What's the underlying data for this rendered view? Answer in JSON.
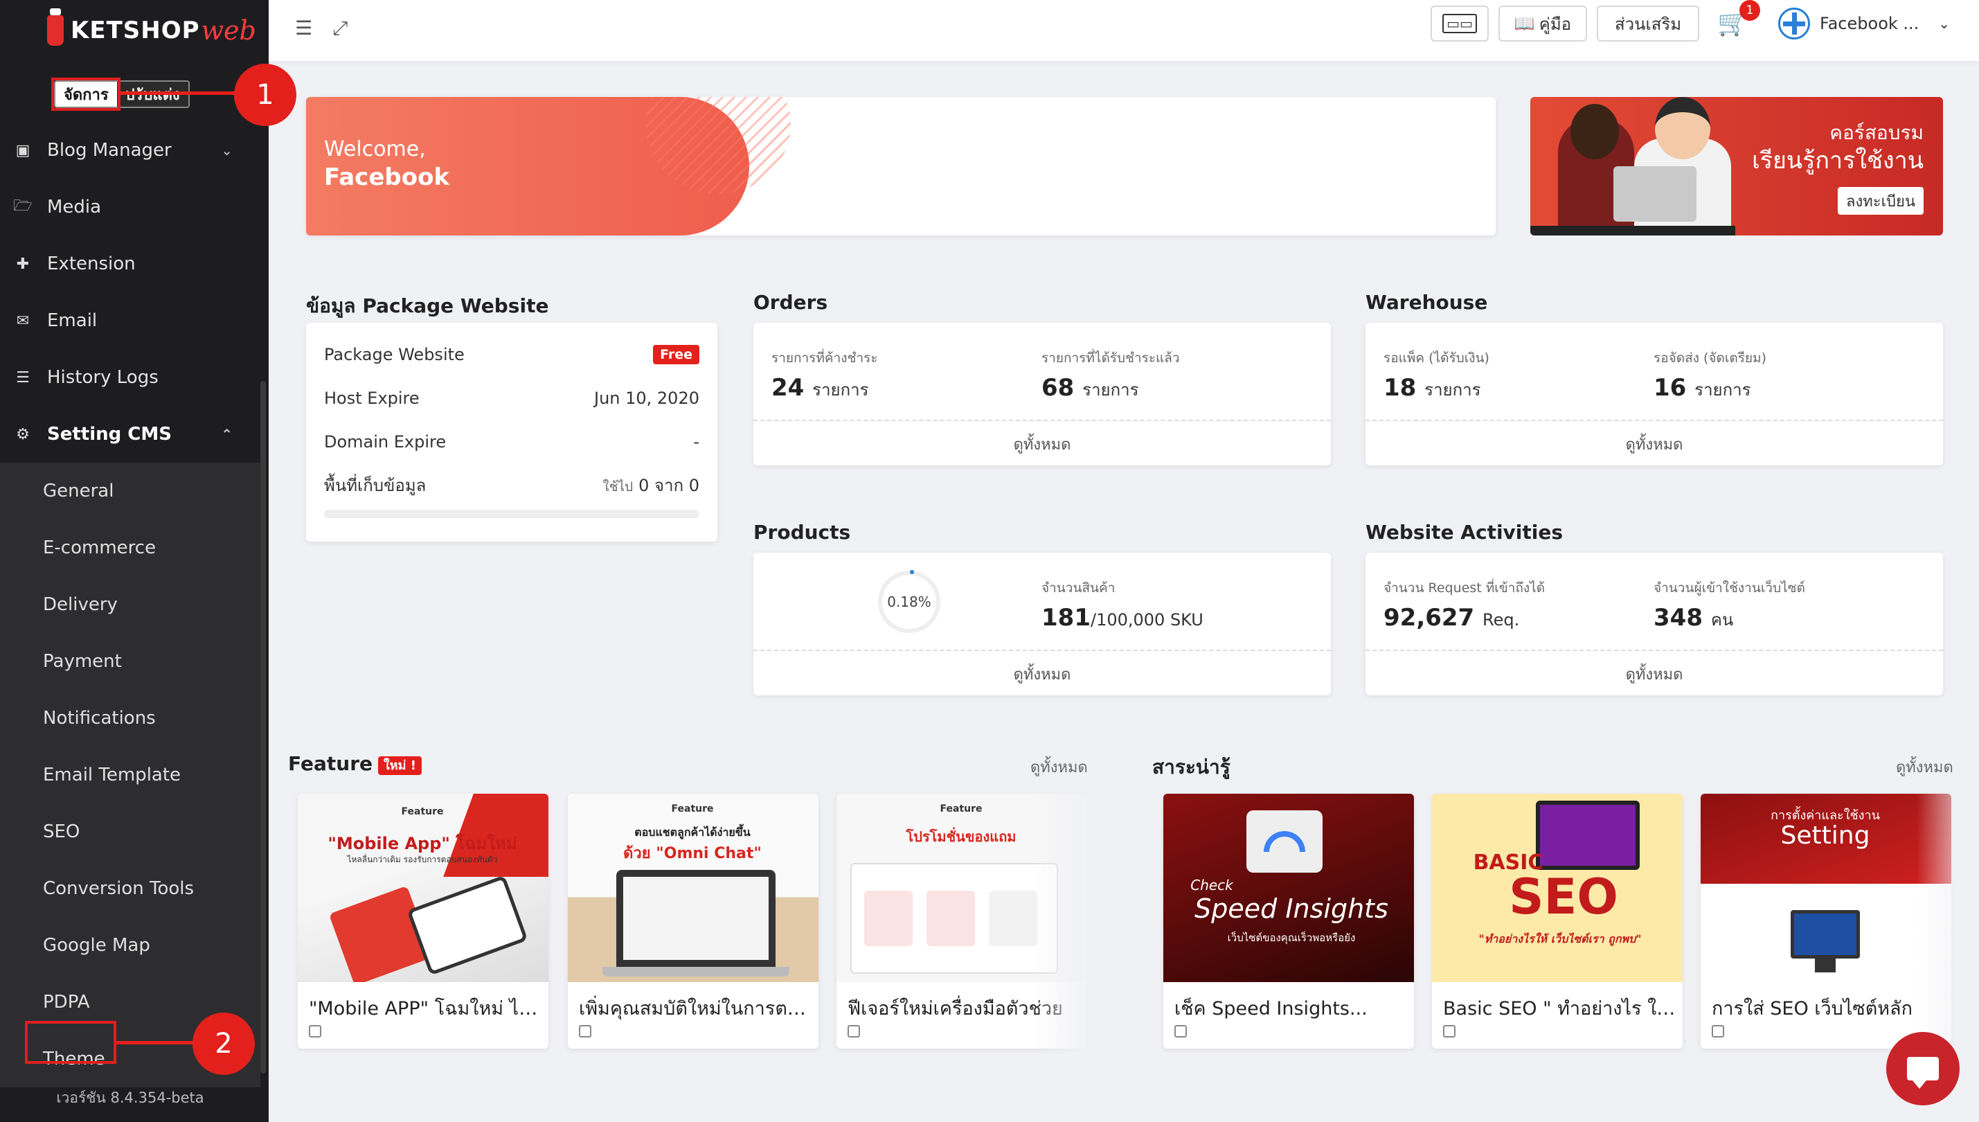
{
  "sidebar": {
    "logo_main": "KETSHOP",
    "logo_accent": "web",
    "lang": [
      "จัดการ",
      "ปรับแต่ง"
    ],
    "items": [
      {
        "label": "Blog Manager",
        "icon": "blog-icon"
      },
      {
        "label": "Media",
        "icon": "folder-icon"
      },
      {
        "label": "Extension",
        "icon": "puzzle-icon"
      },
      {
        "label": "Email",
        "icon": "envelope-icon"
      },
      {
        "label": "History Logs",
        "icon": "list-icon"
      },
      {
        "label": "Setting CMS",
        "icon": "gear-icon"
      }
    ],
    "sub_items": [
      "General",
      "E-commerce",
      "Delivery",
      "Payment",
      "Notifications",
      "Email Template",
      "SEO",
      "Conversion Tools",
      "Google Map",
      "PDPA",
      "Theme"
    ],
    "version": "เวอร์ชัน 8.4.354-beta"
  },
  "callouts": {
    "one": "1",
    "two": "2"
  },
  "topbar": {
    "manual_label": "คู่มือ",
    "addon_label": "ส่วนเสริม",
    "cart_count": "1",
    "user_name": "Facebook ..."
  },
  "welcome": {
    "greeting": "Welcome,",
    "name": "Facebook"
  },
  "promo": {
    "line1": "คอร์สอบรม",
    "line2": "เรียนรู้การใช้งาน",
    "cta": "ลงทะเบียน"
  },
  "package": {
    "title": "ข้อมูล Package Website",
    "rows": [
      {
        "label": "Package Website",
        "value": "Free"
      },
      {
        "label": "Host Expire",
        "value": "Jun 10, 2020"
      },
      {
        "label": "Domain Expire",
        "value": "-"
      },
      {
        "label": "พื้นที่เก็บข้อมูล",
        "value_prefix": "ใช้ไป",
        "value": "0 จาก 0"
      }
    ]
  },
  "orders": {
    "title": "Orders",
    "s1_label": "รายการที่ค้างชำระ",
    "s1_value": "24",
    "s1_unit": "รายการ",
    "s2_label": "รายการที่ได้รับชำระแล้ว",
    "s2_value": "68",
    "s2_unit": "รายการ",
    "view_all": "ดูทั้งหมด"
  },
  "warehouse": {
    "title": "Warehouse",
    "s1_label": "รอแพ็ค (ได้รับเงิน)",
    "s1_value": "18",
    "s1_unit": "รายการ",
    "s2_label": "รอจัดส่ง (จัดเตรียม)",
    "s2_value": "16",
    "s2_unit": "รายการ",
    "view_all": "ดูทั้งหมด"
  },
  "products": {
    "title": "Products",
    "ring": "0.18%",
    "label": "จำนวนสินค้า",
    "value": "181",
    "total": "/100,000 SKU",
    "view_all": "ดูทั้งหมด"
  },
  "activities": {
    "title": "Website Activities",
    "s1_label": "จำนวน Request ที่เข้าถึงได้",
    "s1_value": "92,627",
    "s1_unit": "Req.",
    "s2_label": "จำนวนผู้เข้าใช้งานเว็บไซต์",
    "s2_value": "348",
    "s2_unit": "คน",
    "view_all": "ดูทั้งหมด"
  },
  "feature": {
    "title": "Feature",
    "badge": "ใหม่ !",
    "view_all": "ดูทั้งหมด",
    "cards": [
      {
        "title": "\"Mobile APP\" โฉมใหม่ ไหล...",
        "tag": "Feature",
        "art1": "\"Mobile App\" โฉมใหม่",
        "art2": "ไหลลื่นกว่าเดิม รองรับการตอบสนองทันตัว"
      },
      {
        "title": "เพิ่มคุณสมบัติใหม่ในการตอ...",
        "tag": "Feature",
        "art1": "ตอบแชตลูกค้าได้ง่ายขึ้น",
        "art2": "ด้วย \"Omni Chat\""
      },
      {
        "title": "ฟีเจอร์ใหม่เครื่องมือตัวช่วย",
        "tag": "Feature",
        "art1": "โปรโมชั่นของแถม",
        "art2": ""
      }
    ]
  },
  "knowledge": {
    "title": "สาระน่ารู้",
    "view_all": "ดูทั้งหมด",
    "cards": [
      {
        "title": "เช็ค Speed Insights...",
        "art1": "Check",
        "art2": "Speed Insights",
        "art3": "เว็บไซต์ของคุณเร็วพอหรือยัง"
      },
      {
        "title": "Basic SEO \" ทำอย่างไร ให้...",
        "art1": "BASIC",
        "art2": "SEO",
        "art3": "\"ทำอย่างไรให้ เว็บไซต์เรา ถูกพบ\""
      },
      {
        "title": "การใส่ SEO เว็บไซต์หลัก",
        "art1": "การตั้งค่าและใช้งาน",
        "art2": "Setting",
        "art3": ""
      }
    ]
  },
  "colors": {
    "accent": "#e3201b",
    "sidebar": "#1d1d1f",
    "bg": "#f0f1f4"
  }
}
